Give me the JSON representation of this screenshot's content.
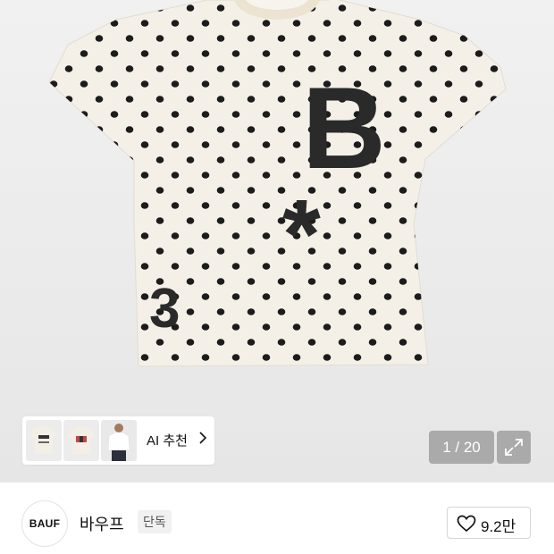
{
  "product_image": {
    "graphic_letter": "B",
    "graphic_star": "*",
    "graphic_number": "3"
  },
  "recommendations": {
    "thumbnails": [
      "dotted-tee-thumbnail",
      "graphic-tee-thumbnail",
      "model-tee-thumbnail"
    ],
    "label": "AI 추천"
  },
  "gallery": {
    "counter": "1 / 20"
  },
  "store": {
    "logo_text": "BAUF",
    "name": "바우프",
    "badge": "단독",
    "likes": "9.2만"
  }
}
